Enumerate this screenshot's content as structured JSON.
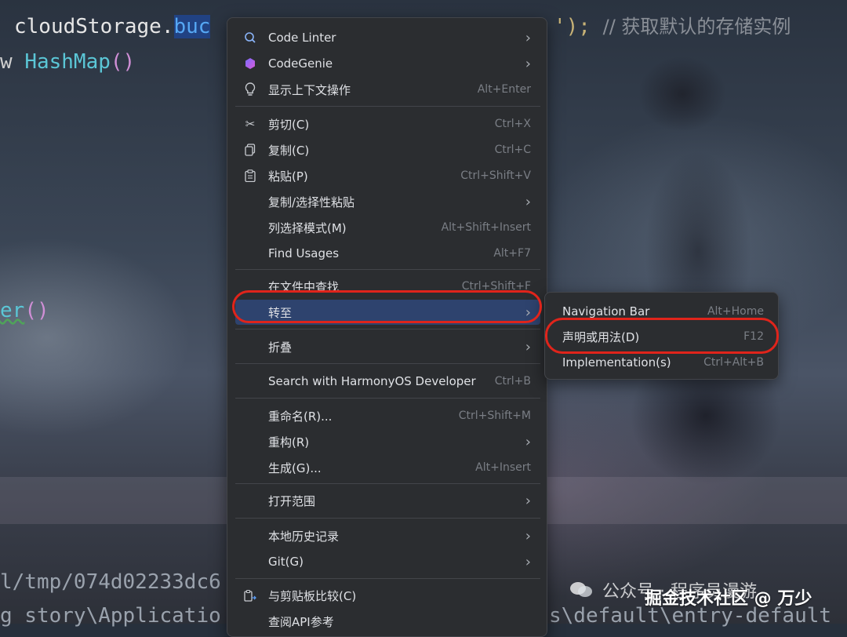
{
  "code": {
    "line1_obj": "cloudStorage.",
    "line1_selected": "buc",
    "line1_tail": "');",
    "line1_comment": "// 获取默认的存储实例",
    "line2_kw": "w",
    "line2_cls": "HashMap",
    "line2_parens": "()",
    "line3_fn": "er",
    "line3_parens": "()",
    "line4": "l/tmp/074d02233dc6",
    "line5_left": "g story\\Applicatio",
    "line5_right": "s\\default\\entry-default"
  },
  "context_menu": {
    "items": [
      {
        "label": "Code Linter",
        "shortcut": "",
        "submenu": true,
        "icon": "code-linter-icon"
      },
      {
        "label": "CodeGenie",
        "shortcut": "",
        "submenu": true,
        "icon": "codegenie-icon"
      },
      {
        "label": "显示上下文操作",
        "shortcut": "Alt+Enter",
        "submenu": false,
        "icon": "lightbulb-icon"
      },
      {
        "label": "剪切(C)",
        "shortcut": "Ctrl+X",
        "submenu": false,
        "icon": "scissors-icon"
      },
      {
        "label": "复制(C)",
        "shortcut": "Ctrl+C",
        "submenu": false,
        "icon": "copy-icon"
      },
      {
        "label": "粘贴(P)",
        "shortcut": "Ctrl+Shift+V",
        "submenu": false,
        "icon": "paste-icon"
      },
      {
        "label": "复制/选择性粘贴",
        "shortcut": "",
        "submenu": true,
        "icon": ""
      },
      {
        "label": "列选择模式(M)",
        "shortcut": "Alt+Shift+Insert",
        "submenu": false,
        "icon": ""
      },
      {
        "label": "Find Usages",
        "shortcut": "Alt+F7",
        "submenu": false,
        "icon": ""
      },
      {
        "label": "在文件中查找",
        "shortcut": "Ctrl+Shift+F",
        "submenu": false,
        "icon": ""
      },
      {
        "label": "转至",
        "shortcut": "",
        "submenu": true,
        "icon": ""
      },
      {
        "label": "折叠",
        "shortcut": "",
        "submenu": true,
        "icon": ""
      },
      {
        "label": "Search with HarmonyOS Developer",
        "shortcut": "Ctrl+B",
        "submenu": false,
        "icon": ""
      },
      {
        "label": "重命名(R)...",
        "shortcut": "Ctrl+Shift+M",
        "submenu": false,
        "icon": ""
      },
      {
        "label": "重构(R)",
        "shortcut": "",
        "submenu": true,
        "icon": ""
      },
      {
        "label": "生成(G)...",
        "shortcut": "Alt+Insert",
        "submenu": false,
        "icon": ""
      },
      {
        "label": "打开范围",
        "shortcut": "",
        "submenu": true,
        "icon": ""
      },
      {
        "label": "本地历史记录",
        "shortcut": "",
        "submenu": true,
        "icon": ""
      },
      {
        "label": "Git(G)",
        "shortcut": "",
        "submenu": true,
        "icon": ""
      },
      {
        "label": "与剪贴板比较(C)",
        "shortcut": "",
        "submenu": false,
        "icon": "compare-icon"
      },
      {
        "label": "查阅API参考",
        "shortcut": "",
        "submenu": false,
        "icon": ""
      }
    ]
  },
  "goto_submenu": {
    "items": [
      {
        "label": "Navigation Bar",
        "shortcut": "Alt+Home"
      },
      {
        "label": "声明或用法(D)",
        "shortcut": "F12"
      },
      {
        "label": "Implementation(s)",
        "shortcut": "Ctrl+Alt+B"
      }
    ]
  },
  "watermark": {
    "wechat": "公众号 · 程序员漫游",
    "juejin": "掘金技术社区 @ 万少"
  },
  "colors": {
    "menu_bg": "#2b2d30",
    "highlight": "#2e436e",
    "annotation_ring": "#e0241b"
  }
}
